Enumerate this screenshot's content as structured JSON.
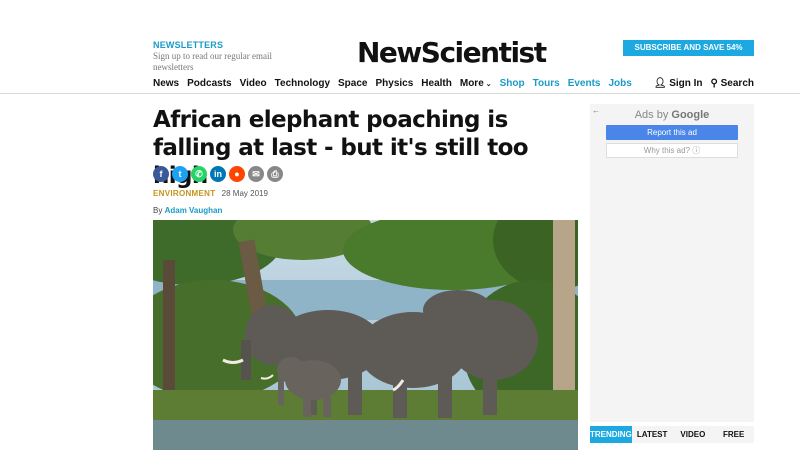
{
  "header": {
    "newsletter_label": "NEWSLETTERS",
    "newsletter_text": "Sign up to read our regular email newsletters",
    "logo": "NewScientist",
    "subscribe": "SUBSCRIBE AND SAVE 54%"
  },
  "nav": {
    "items": [
      "News",
      "Podcasts",
      "Video",
      "Technology",
      "Space",
      "Physics",
      "Health",
      "More",
      "Shop",
      "Tours",
      "Events",
      "Jobs"
    ],
    "sign_in": "Sign In",
    "search": "Search"
  },
  "article": {
    "headline": "African elephant poaching is falling at last - but it's still too high",
    "category": "ENVIRONMENT",
    "date": "28 May 2019",
    "by_prefix": "By",
    "author": "Adam Vaughan",
    "share_icons": [
      "facebook-icon",
      "twitter-icon",
      "whatsapp-icon",
      "linkedin-icon",
      "reddit-icon",
      "email-icon",
      "print-icon"
    ],
    "share_colors": [
      "#3b5998",
      "#1da1f2",
      "#25d366",
      "#0077b5",
      "#ff4500",
      "#888888",
      "#888888"
    ]
  },
  "ad": {
    "back": "←",
    "ads_by": "Ads by",
    "google": "Google",
    "report": "Report this ad",
    "why": "Why this ad? ⓘ"
  },
  "sidebar_tabs": [
    "TRENDING",
    "LATEST",
    "VIDEO",
    "FREE"
  ],
  "colors": {
    "accent": "#1ca9e1",
    "category": "#c6951c"
  }
}
